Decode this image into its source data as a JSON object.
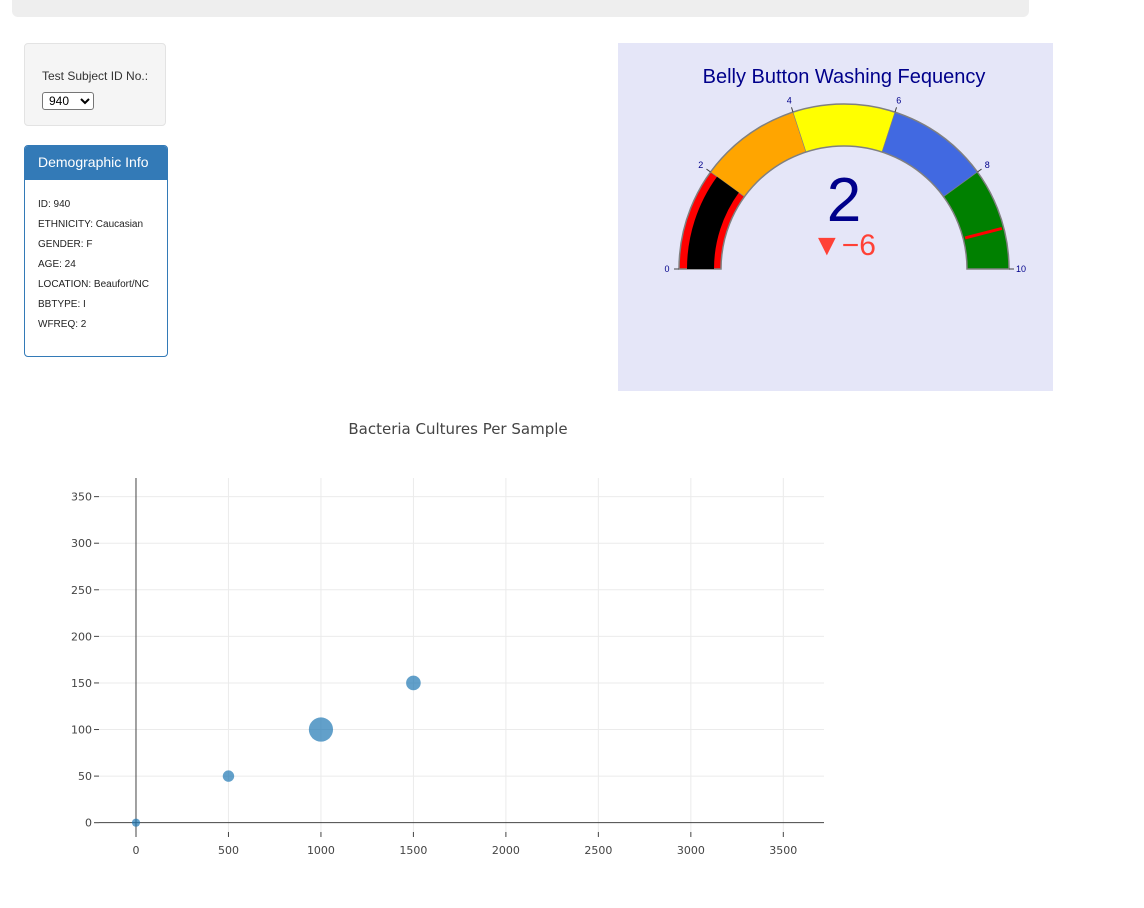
{
  "selector": {
    "label": "Test Subject ID No.:",
    "selected_value": "940"
  },
  "demographics": {
    "title": "Demographic Info",
    "lines": [
      "ID: 940",
      "ETHNICITY: Caucasian",
      "GENDER: F",
      "AGE: 24",
      "LOCATION: Beaufort/NC",
      "BBTYPE: I",
      "WFREQ: 2"
    ]
  },
  "chart_data": [
    {
      "type": "gauge",
      "title": "Belly Button Washing Fequency",
      "value": 2,
      "value_text": "2",
      "delta": -6,
      "delta_text": "▼−6",
      "range": [
        0,
        10
      ],
      "ticks": [
        0,
        2,
        4,
        6,
        8,
        10
      ],
      "tick_labels": [
        "0",
        "2",
        "4",
        "6",
        "8",
        "10"
      ],
      "bands": [
        {
          "from": 0,
          "to": 2,
          "color": "#ff0000"
        },
        {
          "from": 2,
          "to": 4,
          "color": "#ffa500"
        },
        {
          "from": 4,
          "to": 6,
          "color": "#ffff00"
        },
        {
          "from": 6,
          "to": 8,
          "color": "#4169e1"
        },
        {
          "from": 8,
          "to": 10,
          "color": "#008000"
        }
      ],
      "bar_color": "#000000",
      "threshold": 9.2,
      "threshold_color": "#ff0000",
      "colors": {
        "title": "#00008b",
        "number": "#00008b",
        "delta": "#ff4136",
        "background": "#e5e6f8",
        "outline": "#808080"
      }
    },
    {
      "type": "scatter",
      "title": "Bacteria Cultures Per Sample",
      "x": [
        0,
        500,
        1000,
        1500
      ],
      "y": [
        0,
        50,
        100,
        150
      ],
      "sizes": [
        1,
        2,
        6,
        3
      ],
      "marker_color": "#1f77b4",
      "xlim": [
        -200,
        3720
      ],
      "ylim": [
        -10,
        370
      ],
      "xticks": [
        0,
        500,
        1000,
        1500,
        2000,
        2500,
        3000,
        3500
      ],
      "xtick_labels": [
        "0",
        "500",
        "1000",
        "1500",
        "2000",
        "2500",
        "3000",
        "3500"
      ],
      "yticks": [
        0,
        50,
        100,
        150,
        200,
        250,
        300,
        350
      ],
      "ytick_labels": [
        "0",
        "50",
        "100",
        "150",
        "200",
        "250",
        "300",
        "350"
      ],
      "grid": true
    }
  ]
}
